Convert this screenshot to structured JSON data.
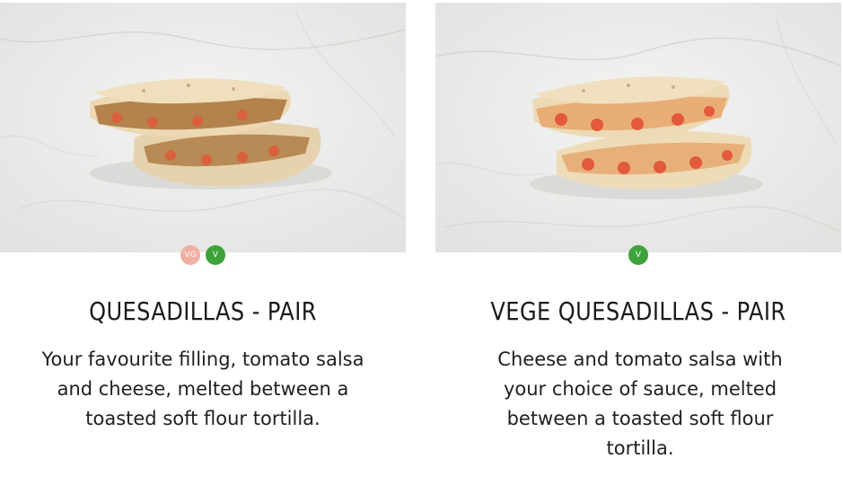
{
  "products": [
    {
      "title": "QUESADILLAS - PAIR",
      "description": "Your favourite filling, tomato salsa and cheese, melted between a toasted soft flour tortilla.",
      "badges": [
        {
          "label": "VG",
          "color": "#f1aea3"
        },
        {
          "label": "V",
          "color": "#3da33a"
        }
      ]
    },
    {
      "title": "VEGE QUESADILLAS - PAIR",
      "description": "Cheese and tomato salsa with your choice of sauce, melted between a toasted soft flour tortilla.",
      "badges": [
        {
          "label": "V",
          "color": "#3da33a"
        }
      ]
    }
  ]
}
